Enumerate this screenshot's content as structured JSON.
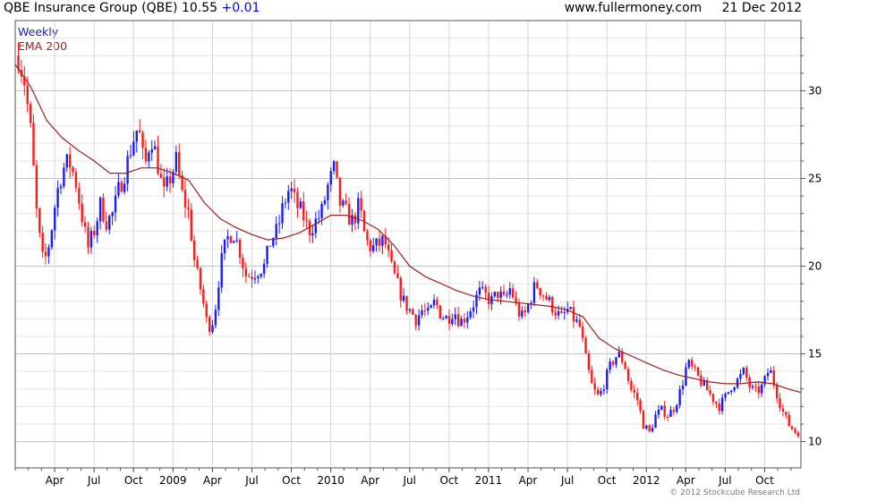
{
  "header": {
    "title": "QBE Insurance Group (QBE)",
    "price": "10.55",
    "change": "+0.01",
    "site": "www.fullermoney.com",
    "date": "21 Dec 2012"
  },
  "legend": {
    "weekly": "Weekly",
    "ema": "EMA 200"
  },
  "copyright": "© 2012 Stockcube Research Ltd",
  "colors": {
    "up": "#1a1aff",
    "down": "#ff1a1a",
    "ema": "#a02020",
    "grid": "#c8c8c8"
  },
  "chart_data": {
    "type": "candlestick",
    "title": "QBE Insurance Group (QBE)",
    "ylim": [
      8.5,
      34
    ],
    "yticks": [
      10,
      15,
      20,
      25,
      30
    ],
    "x_range": [
      2008.0,
      2012.98
    ],
    "xticks": [
      {
        "label": "Apr",
        "x": 2008.25
      },
      {
        "label": "Jul",
        "x": 2008.5
      },
      {
        "label": "Oct",
        "x": 2008.75
      },
      {
        "label": "2009",
        "x": 2009.0
      },
      {
        "label": "Apr",
        "x": 2009.25
      },
      {
        "label": "Jul",
        "x": 2009.5
      },
      {
        "label": "Oct",
        "x": 2009.75
      },
      {
        "label": "2010",
        "x": 2010.0
      },
      {
        "label": "Apr",
        "x": 2010.25
      },
      {
        "label": "Jul",
        "x": 2010.5
      },
      {
        "label": "Oct",
        "x": 2010.75
      },
      {
        "label": "2011",
        "x": 2011.0
      },
      {
        "label": "Apr",
        "x": 2011.25
      },
      {
        "label": "Jul",
        "x": 2011.5
      },
      {
        "label": "Oct",
        "x": 2011.75
      },
      {
        "label": "2012",
        "x": 2012.0
      },
      {
        "label": "Apr",
        "x": 2012.25
      },
      {
        "label": "Jul",
        "x": 2012.5
      },
      {
        "label": "Oct",
        "x": 2012.75
      }
    ],
    "weekly_close": [
      [
        2008.02,
        32.0
      ],
      [
        2008.06,
        30.5
      ],
      [
        2008.1,
        27.5
      ],
      [
        2008.14,
        22.5
      ],
      [
        2008.18,
        20.0
      ],
      [
        2008.22,
        21.5
      ],
      [
        2008.26,
        24.0
      ],
      [
        2008.3,
        25.5
      ],
      [
        2008.34,
        26.0
      ],
      [
        2008.38,
        25.0
      ],
      [
        2008.42,
        23.0
      ],
      [
        2008.46,
        21.0
      ],
      [
        2008.5,
        22.0
      ],
      [
        2008.54,
        23.5
      ],
      [
        2008.58,
        22.5
      ],
      [
        2008.62,
        23.0
      ],
      [
        2008.66,
        24.5
      ],
      [
        2008.7,
        25.5
      ],
      [
        2008.74,
        27.0
      ],
      [
        2008.78,
        28.0
      ],
      [
        2008.82,
        25.5
      ],
      [
        2008.86,
        27.5
      ],
      [
        2008.9,
        26.0
      ],
      [
        2008.94,
        24.0
      ],
      [
        2008.98,
        25.0
      ],
      [
        2009.02,
        26.0
      ],
      [
        2009.06,
        24.0
      ],
      [
        2009.1,
        23.0
      ],
      [
        2009.14,
        20.0
      ],
      [
        2009.18,
        18.5
      ],
      [
        2009.22,
        16.5
      ],
      [
        2009.26,
        17.0
      ],
      [
        2009.3,
        20.0
      ],
      [
        2009.34,
        21.5
      ],
      [
        2009.38,
        22.0
      ],
      [
        2009.42,
        21.0
      ],
      [
        2009.46,
        19.5
      ],
      [
        2009.5,
        19.5
      ],
      [
        2009.54,
        19.8
      ],
      [
        2009.58,
        20.0
      ],
      [
        2009.62,
        21.5
      ],
      [
        2009.66,
        22.0
      ],
      [
        2009.7,
        23.5
      ],
      [
        2009.74,
        24.5
      ],
      [
        2009.78,
        23.5
      ],
      [
        2009.82,
        23.0
      ],
      [
        2009.86,
        22.0
      ],
      [
        2009.9,
        22.5
      ],
      [
        2009.94,
        23.0
      ],
      [
        2009.98,
        24.5
      ],
      [
        2010.02,
        25.5
      ],
      [
        2010.06,
        23.5
      ],
      [
        2010.1,
        23.0
      ],
      [
        2010.14,
        22.5
      ],
      [
        2010.18,
        23.5
      ],
      [
        2010.22,
        21.5
      ],
      [
        2010.26,
        21.0
      ],
      [
        2010.3,
        21.2
      ],
      [
        2010.34,
        21.5
      ],
      [
        2010.38,
        20.0
      ],
      [
        2010.42,
        19.0
      ],
      [
        2010.46,
        18.0
      ],
      [
        2010.5,
        17.5
      ],
      [
        2010.54,
        17.0
      ],
      [
        2010.58,
        17.5
      ],
      [
        2010.62,
        17.2
      ],
      [
        2010.66,
        18.0
      ],
      [
        2010.7,
        17.2
      ],
      [
        2010.74,
        17.0
      ],
      [
        2010.78,
        17.5
      ],
      [
        2010.82,
        16.8
      ],
      [
        2010.86,
        17.2
      ],
      [
        2010.9,
        17.8
      ],
      [
        2010.94,
        18.5
      ],
      [
        2010.98,
        18.3
      ],
      [
        2011.02,
        18.0
      ],
      [
        2011.06,
        18.5
      ],
      [
        2011.1,
        18.0
      ],
      [
        2011.14,
        18.8
      ],
      [
        2011.18,
        17.5
      ],
      [
        2011.22,
        17.0
      ],
      [
        2011.26,
        18.0
      ],
      [
        2011.3,
        19.0
      ],
      [
        2011.34,
        18.5
      ],
      [
        2011.38,
        18.0
      ],
      [
        2011.42,
        17.5
      ],
      [
        2011.46,
        17.0
      ],
      [
        2011.5,
        17.5
      ],
      [
        2011.54,
        17.0
      ],
      [
        2011.58,
        16.5
      ],
      [
        2011.62,
        14.5
      ],
      [
        2011.66,
        13.0
      ],
      [
        2011.7,
        12.5
      ],
      [
        2011.74,
        13.5
      ],
      [
        2011.78,
        14.5
      ],
      [
        2011.82,
        15.0
      ],
      [
        2011.86,
        14.5
      ],
      [
        2011.9,
        13.0
      ],
      [
        2011.94,
        12.5
      ],
      [
        2011.98,
        11.0
      ],
      [
        2012.02,
        10.5
      ],
      [
        2012.06,
        11.5
      ],
      [
        2012.1,
        11.8
      ],
      [
        2012.14,
        11.5
      ],
      [
        2012.18,
        12.0
      ],
      [
        2012.22,
        13.0
      ],
      [
        2012.26,
        14.5
      ],
      [
        2012.3,
        14.0
      ],
      [
        2012.34,
        13.5
      ],
      [
        2012.38,
        13.0
      ],
      [
        2012.42,
        12.5
      ],
      [
        2012.46,
        12.0
      ],
      [
        2012.5,
        12.5
      ],
      [
        2012.54,
        13.2
      ],
      [
        2012.58,
        13.5
      ],
      [
        2012.62,
        14.0
      ],
      [
        2012.66,
        13.0
      ],
      [
        2012.7,
        12.8
      ],
      [
        2012.74,
        13.2
      ],
      [
        2012.78,
        14.2
      ],
      [
        2012.82,
        13.0
      ],
      [
        2012.86,
        11.8
      ],
      [
        2012.9,
        11.0
      ],
      [
        2012.94,
        10.6
      ],
      [
        2012.97,
        10.55
      ]
    ],
    "ema200": [
      [
        2008.0,
        31.5
      ],
      [
        2008.1,
        30.2
      ],
      [
        2008.2,
        28.3
      ],
      [
        2008.3,
        27.3
      ],
      [
        2008.4,
        26.6
      ],
      [
        2008.5,
        26.0
      ],
      [
        2008.6,
        25.3
      ],
      [
        2008.7,
        25.3
      ],
      [
        2008.8,
        25.6
      ],
      [
        2008.9,
        25.6
      ],
      [
        2009.0,
        25.3
      ],
      [
        2009.1,
        24.9
      ],
      [
        2009.2,
        23.6
      ],
      [
        2009.3,
        22.7
      ],
      [
        2009.4,
        22.2
      ],
      [
        2009.5,
        21.8
      ],
      [
        2009.6,
        21.5
      ],
      [
        2009.7,
        21.6
      ],
      [
        2009.8,
        21.9
      ],
      [
        2009.9,
        22.4
      ],
      [
        2010.0,
        22.9
      ],
      [
        2010.1,
        22.9
      ],
      [
        2010.2,
        22.6
      ],
      [
        2010.3,
        22.1
      ],
      [
        2010.4,
        21.2
      ],
      [
        2010.5,
        20.0
      ],
      [
        2010.6,
        19.4
      ],
      [
        2010.7,
        19.0
      ],
      [
        2010.8,
        18.6
      ],
      [
        2010.9,
        18.3
      ],
      [
        2011.0,
        18.1
      ],
      [
        2011.1,
        18.0
      ],
      [
        2011.2,
        17.9
      ],
      [
        2011.3,
        17.8
      ],
      [
        2011.4,
        17.7
      ],
      [
        2011.5,
        17.5
      ],
      [
        2011.6,
        17.1
      ],
      [
        2011.7,
        15.9
      ],
      [
        2011.8,
        15.3
      ],
      [
        2011.9,
        14.9
      ],
      [
        2012.0,
        14.5
      ],
      [
        2012.1,
        14.1
      ],
      [
        2012.2,
        13.8
      ],
      [
        2012.3,
        13.6
      ],
      [
        2012.4,
        13.4
      ],
      [
        2012.5,
        13.3
      ],
      [
        2012.6,
        13.3
      ],
      [
        2012.7,
        13.4
      ],
      [
        2012.8,
        13.3
      ],
      [
        2012.9,
        13.0
      ],
      [
        2012.98,
        12.8
      ]
    ]
  }
}
